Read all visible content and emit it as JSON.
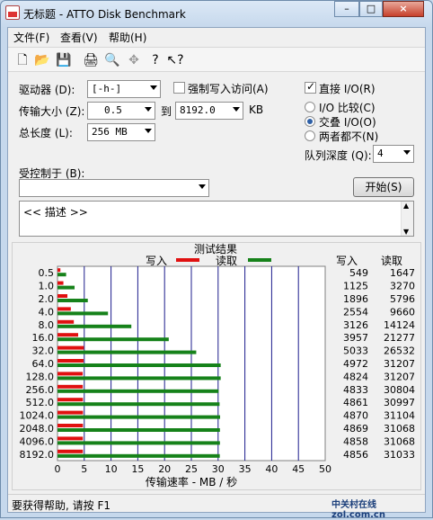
{
  "window": {
    "title": "无标题 - ATTO Disk Benchmark",
    "min": "–",
    "max": "□",
    "close": "×"
  },
  "menu": [
    {
      "label": "文件(F)"
    },
    {
      "label": "查看(V)"
    },
    {
      "label": "帮助(H)"
    }
  ],
  "toolbar": {
    "icons": [
      "new-icon",
      "open-icon",
      "save-icon",
      "print-icon",
      "print-preview-icon",
      "move-icon",
      "help-icon",
      "context-help-icon"
    ]
  },
  "settings": {
    "drive_label": "驱动器 (D):",
    "drive_value": "[-h-]",
    "force_write_label": "强制写入访问(A)",
    "direct_io_label": "直接 I/O(R)",
    "transfer_label": "传输大小 (Z):",
    "transfer_from": "0.5",
    "to_label": "到",
    "transfer_to": "8192.0",
    "kb_label": "KB",
    "total_label": "总长度 (L):",
    "total_value": "256 MB",
    "io_compare_label": "I/O 比较(C)",
    "overlap_io_label": "交叠 I/O(O)",
    "neither_label": "两者都不(N)",
    "queue_label": "队列深度 (Q):",
    "queue_value": "4",
    "controlled_label": "受控制于 (B):",
    "controlled_value": "",
    "start_label": "开始(S)",
    "description": "<< 描述 >>"
  },
  "results": {
    "title": "测试结果",
    "write_legend": "写入",
    "read_legend": "读取",
    "write_col": "写入",
    "read_col": "读取",
    "xlabel": "传输速率 - MB / 秒"
  },
  "chart_data": {
    "type": "bar",
    "title": "测试结果",
    "xlabel": "传输速率 - MB / 秒",
    "xlim": [
      0,
      50
    ],
    "xticks": [
      "0",
      "5",
      "10",
      "15",
      "20",
      "25",
      "30",
      "35",
      "40",
      "45",
      "50"
    ],
    "categories": [
      "0.5",
      "1.0",
      "2.0",
      "4.0",
      "8.0",
      "16.0",
      "32.0",
      "64.0",
      "128.0",
      "256.0",
      "512.0",
      "1024.0",
      "2048.0",
      "4096.0",
      "8192.0"
    ],
    "series": [
      {
        "name": "写入",
        "color": "#e01010",
        "values": [
          0.54,
          1.1,
          1.85,
          2.49,
          3.05,
          3.86,
          4.92,
          4.86,
          4.71,
          4.72,
          4.75,
          4.76,
          4.75,
          4.74,
          4.74
        ]
      },
      {
        "name": "读取",
        "color": "#16821a",
        "values": [
          1.61,
          3.19,
          5.66,
          9.43,
          13.79,
          20.78,
          25.91,
          30.48,
          30.48,
          30.08,
          30.27,
          30.37,
          30.34,
          30.34,
          30.31
        ]
      }
    ],
    "write_values": [
      "549",
      "1125",
      "1896",
      "2554",
      "3126",
      "3957",
      "5033",
      "4972",
      "4824",
      "4833",
      "4861",
      "4870",
      "4869",
      "4858",
      "4856"
    ],
    "read_values": [
      "1647",
      "3270",
      "5796",
      "9660",
      "14124",
      "21277",
      "26532",
      "31207",
      "31207",
      "30804",
      "30997",
      "31104",
      "31068",
      "31068",
      "31033"
    ]
  },
  "status": {
    "text": "要获得帮助, 请按 F1"
  },
  "watermark": {
    "text": "中关村在线 zol.com.cn"
  }
}
